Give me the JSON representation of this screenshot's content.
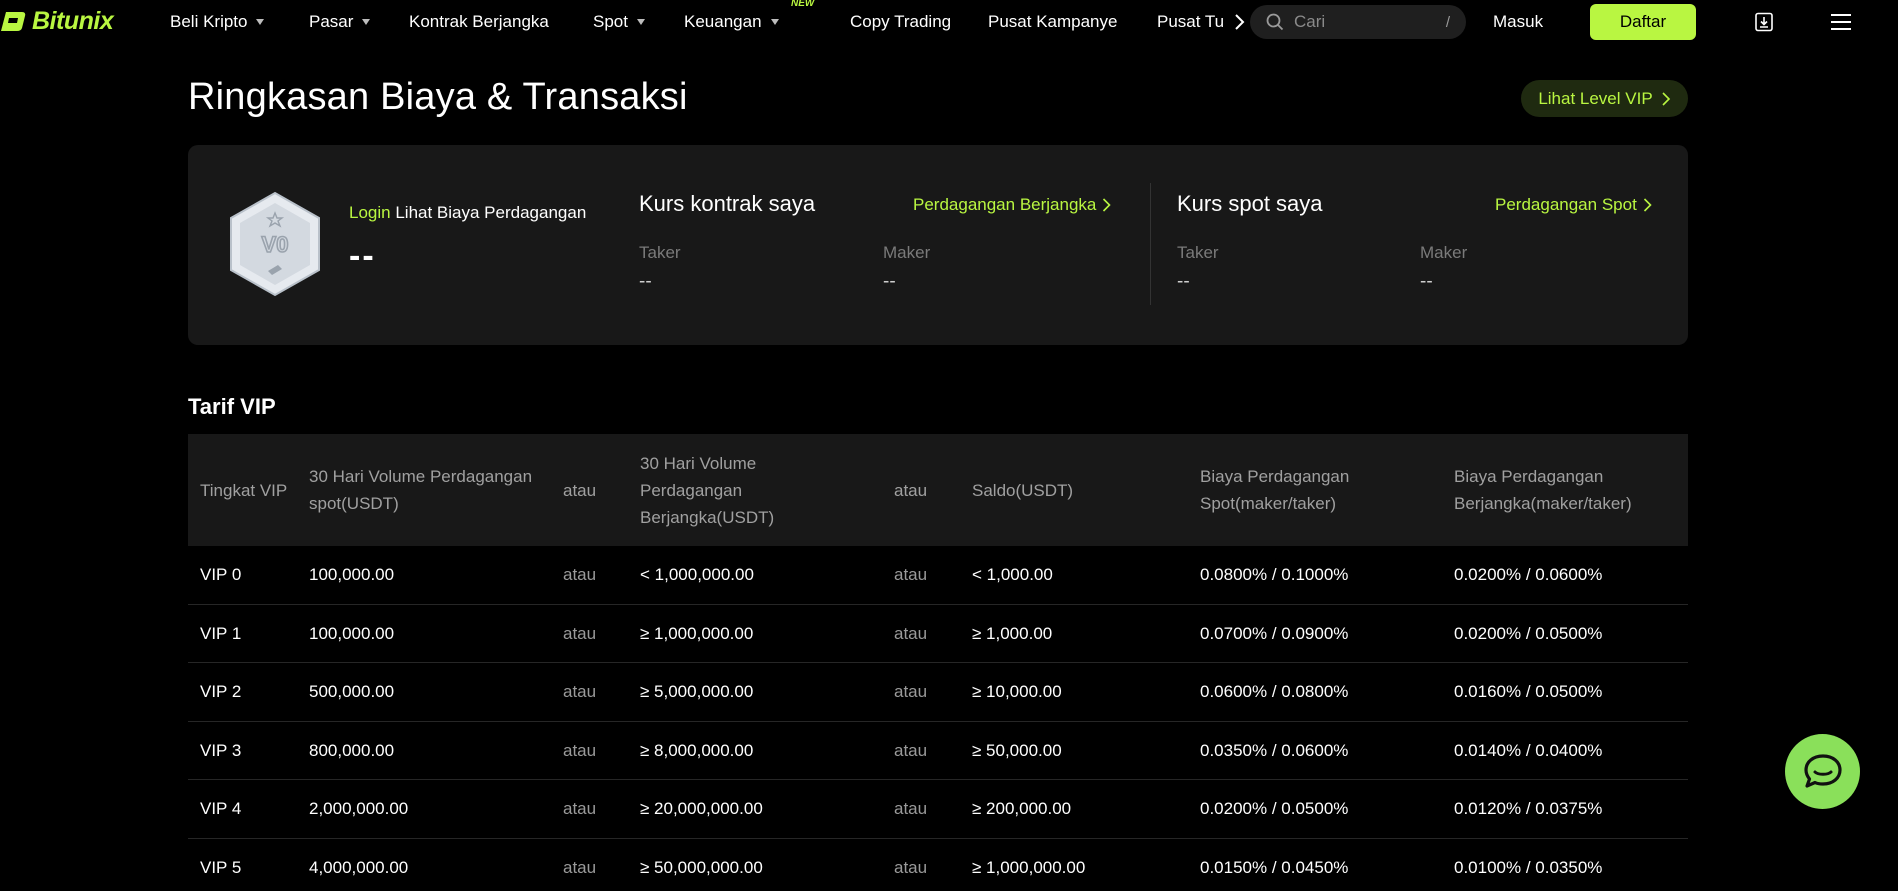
{
  "brand": {
    "name": "Bitunix",
    "accent": "#b9f641"
  },
  "nav": {
    "items": [
      {
        "label": "Beli Kripto",
        "dropdown": true
      },
      {
        "label": "Pasar",
        "dropdown": true
      },
      {
        "label": "Kontrak Berjangka",
        "dropdown": false
      },
      {
        "label": "Spot",
        "dropdown": true
      },
      {
        "label": "Keuangan",
        "dropdown": true,
        "badge": "NEW"
      },
      {
        "label": "Copy Trading",
        "dropdown": false
      },
      {
        "label": "Pusat Kampanye",
        "dropdown": false
      },
      {
        "label": "Pusat Tu",
        "dropdown": false
      }
    ],
    "search_placeholder": "Cari",
    "search_shortcut": "/",
    "login_label": "Masuk",
    "signup_label": "Daftar"
  },
  "header": {
    "title": "Ringkasan Biaya & Transaksi",
    "vip_button": "Lihat Level VIP"
  },
  "summary": {
    "badge_text": "V0",
    "login_link": "Login",
    "login_text": "Lihat Biaya Perdagangan",
    "level_value": "--",
    "contract": {
      "title": "Kurs kontrak saya",
      "link": "Perdagangan Berjangka",
      "taker_label": "Taker",
      "taker_value": "--",
      "maker_label": "Maker",
      "maker_value": "--"
    },
    "spot": {
      "title": "Kurs spot saya",
      "link": "Perdagangan Spot",
      "taker_label": "Taker",
      "taker_value": "--",
      "maker_label": "Maker",
      "maker_value": "--"
    }
  },
  "vip_table": {
    "title": "Tarif VIP",
    "headers": [
      "Tingkat VIP",
      "30 Hari Volume Perdagangan spot(USDT)",
      "atau",
      "30 Hari Volume Perdagangan Berjangka(USDT)",
      "atau",
      "Saldo(USDT)",
      "Biaya Perdagangan Spot(maker/taker)",
      "Biaya Perdagangan Berjangka(maker/taker)"
    ],
    "rows": [
      [
        "VIP 0",
        "100,000.00",
        "atau",
        "< 1,000,000.00",
        "atau",
        "< 1,000.00",
        "0.0800% / 0.1000%",
        "0.0200% / 0.0600%"
      ],
      [
        "VIP 1",
        "100,000.00",
        "atau",
        "≥ 1,000,000.00",
        "atau",
        "≥ 1,000.00",
        "0.0700% / 0.0900%",
        "0.0200% / 0.0500%"
      ],
      [
        "VIP 2",
        "500,000.00",
        "atau",
        "≥ 5,000,000.00",
        "atau",
        "≥ 10,000.00",
        "0.0600% / 0.0800%",
        "0.0160% / 0.0500%"
      ],
      [
        "VIP 3",
        "800,000.00",
        "atau",
        "≥ 8,000,000.00",
        "atau",
        "≥ 50,000.00",
        "0.0350% / 0.0600%",
        "0.0140% / 0.0400%"
      ],
      [
        "VIP 4",
        "2,000,000.00",
        "atau",
        "≥ 20,000,000.00",
        "atau",
        "≥ 200,000.00",
        "0.0200% / 0.0500%",
        "0.0120% / 0.0375%"
      ],
      [
        "VIP 5",
        "4,000,000.00",
        "atau",
        "≥ 50,000,000.00",
        "atau",
        "≥ 1,000,000.00",
        "0.0150% / 0.0450%",
        "0.0100% / 0.0350%"
      ]
    ]
  },
  "icons": {
    "search": "search-icon",
    "nav_next": "chevron-right-icon",
    "download": "download-icon",
    "menu": "menu-icon",
    "chat": "chat-bubble-icon",
    "vip_badge": "vip-badge-icon"
  }
}
